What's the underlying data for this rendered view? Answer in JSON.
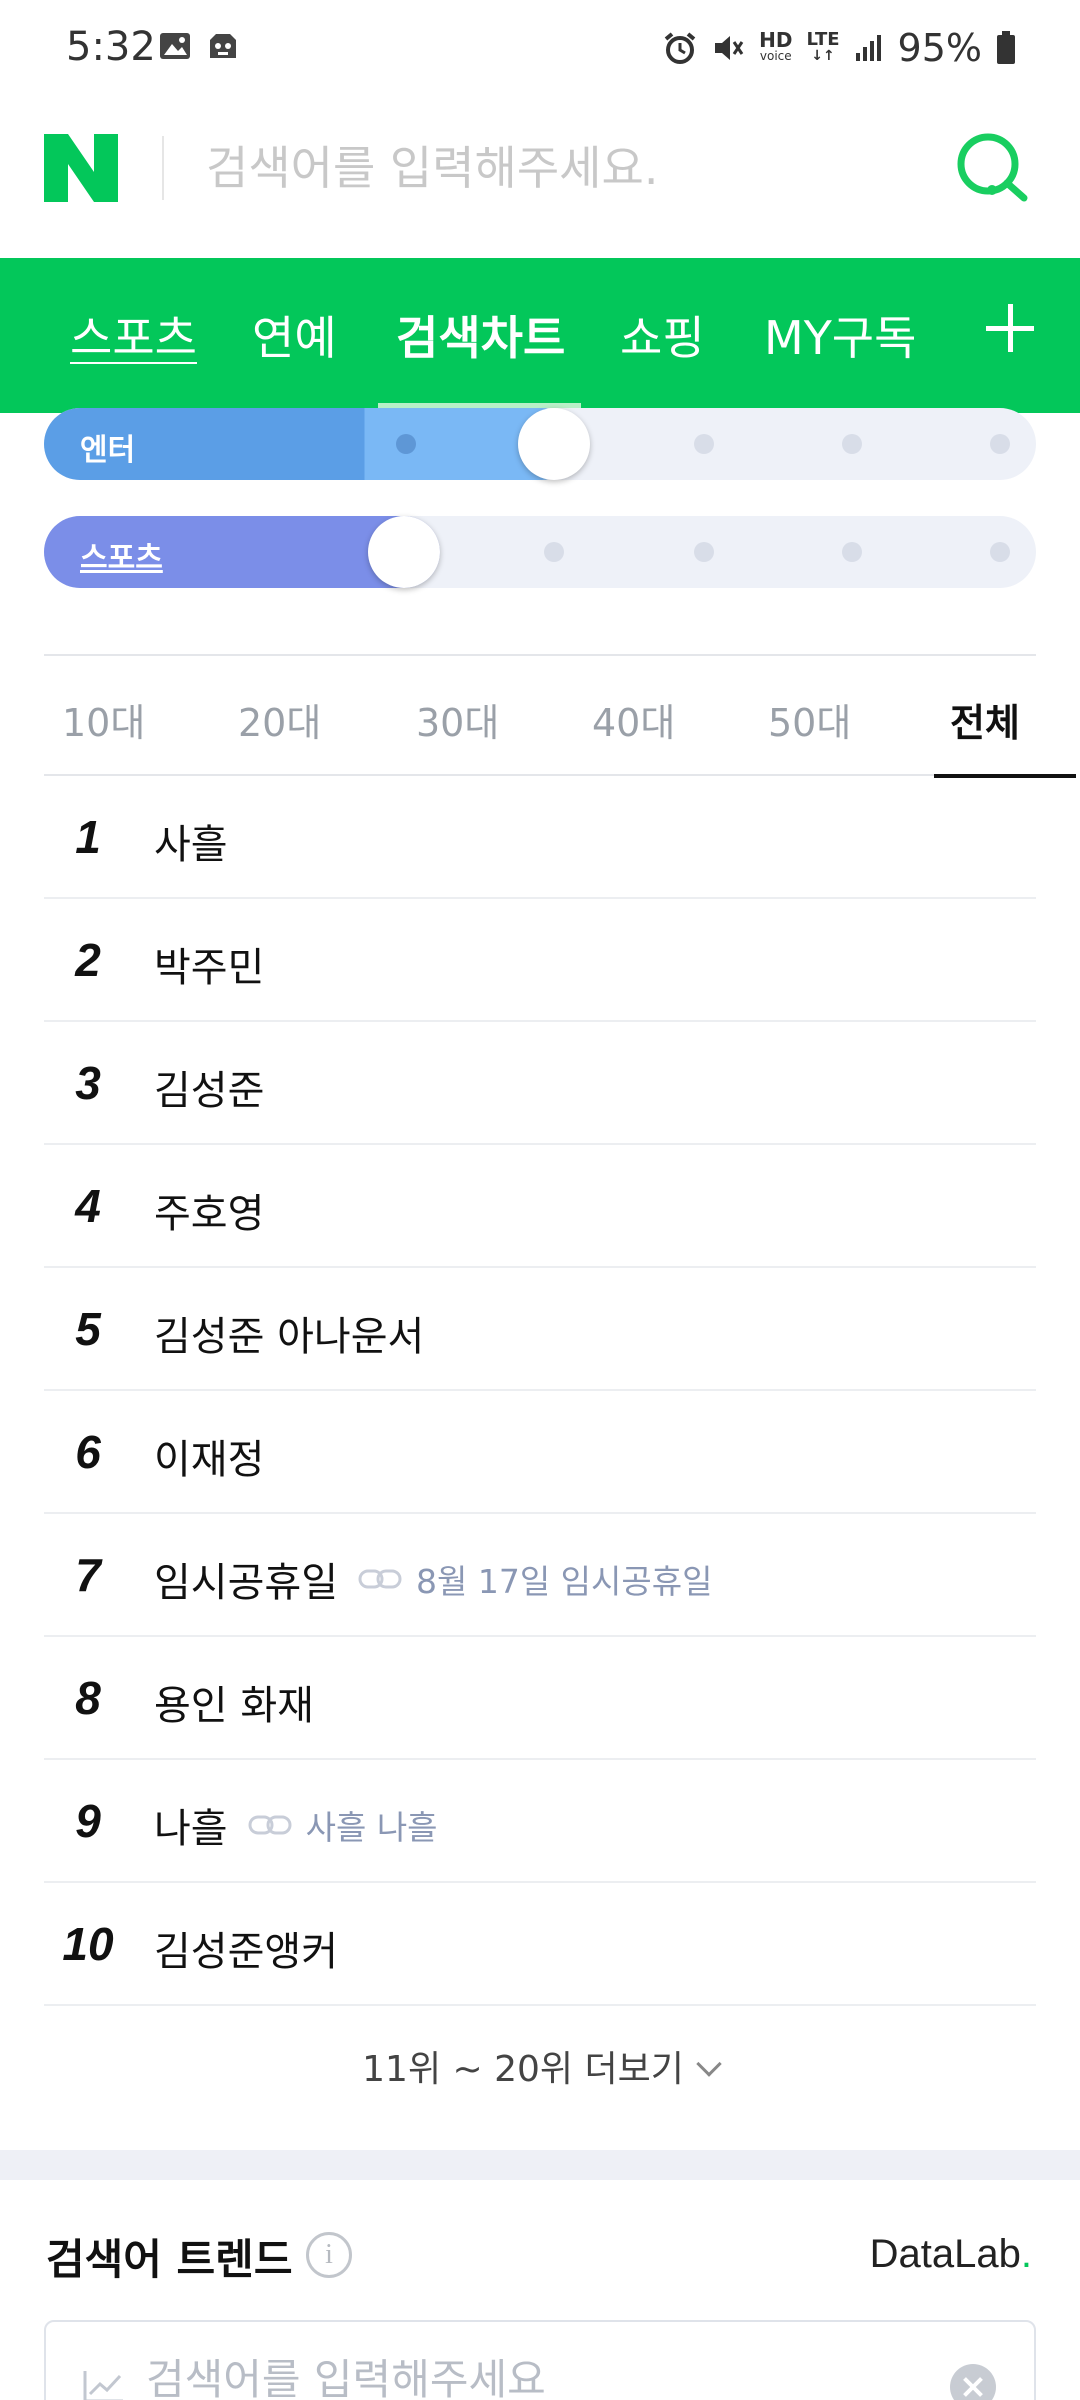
{
  "status_bar": {
    "time": "5:32",
    "hd": "HD",
    "voice": "voice",
    "lte": "LTE",
    "battery": "95%"
  },
  "header": {
    "search_placeholder": "검색어를 입력해주세요."
  },
  "nav": {
    "tabs": [
      "스포츠",
      "연예",
      "검색차트",
      "쇼핑",
      "MY구독"
    ],
    "active": "검색차트"
  },
  "sliders": [
    {
      "label": "엔터",
      "level": 0.5,
      "color": "#5b9ee6"
    },
    {
      "label": "스포츠",
      "level": 0.33,
      "color": "#7b8ee8"
    }
  ],
  "age_tabs": {
    "items": [
      "10대",
      "20대",
      "30대",
      "40대",
      "50대",
      "전체"
    ],
    "active": "전체"
  },
  "ranking": [
    {
      "rank": "1",
      "keyword": "사흘"
    },
    {
      "rank": "2",
      "keyword": "박주민"
    },
    {
      "rank": "3",
      "keyword": "김성준"
    },
    {
      "rank": "4",
      "keyword": "주호영"
    },
    {
      "rank": "5",
      "keyword": "김성준 아나운서"
    },
    {
      "rank": "6",
      "keyword": "이재정"
    },
    {
      "rank": "7",
      "keyword": "임시공휴일",
      "related": "8월 17일 임시공휴일"
    },
    {
      "rank": "8",
      "keyword": "용인 화재"
    },
    {
      "rank": "9",
      "keyword": "나흘",
      "related": "사흘 나흘"
    },
    {
      "rank": "10",
      "keyword": "김성준앵커"
    }
  ],
  "more": {
    "label": "11위 ~ 20위 더보기"
  },
  "trend": {
    "title": "검색어 트렌드",
    "info": "i",
    "brand": "DataLab",
    "brand_dot": ".",
    "input_placeholder": "검색어를 입력해주세요"
  },
  "colors": {
    "naver_green": "#03c75a",
    "related_text": "#8a97b4"
  }
}
